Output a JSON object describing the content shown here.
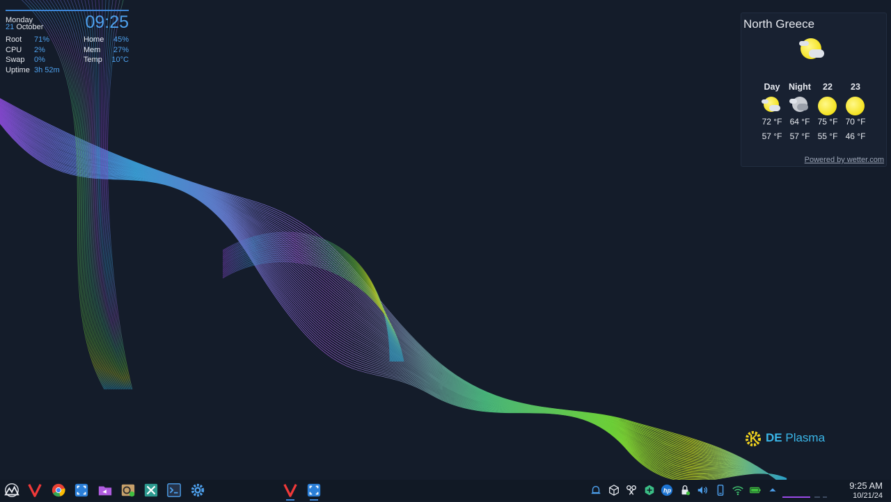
{
  "sysmon": {
    "day": "Monday",
    "date_num": "21",
    "month": "October",
    "time": "09:25",
    "rows": [
      {
        "l1": "Root",
        "v1": "71%",
        "l2": "Home",
        "v2": "45%"
      },
      {
        "l1": "CPU",
        "v1": "2%",
        "l2": "Mem",
        "v2": "27%"
      },
      {
        "l1": "Swap",
        "v1": "0%",
        "l2": "Temp",
        "v2": "10°C"
      },
      {
        "l1": "Uptime",
        "v1": "3h 52m"
      }
    ]
  },
  "weather": {
    "location": "North Greece",
    "current_icon": "sun-cloud-icon",
    "forecast": [
      {
        "label": "Day",
        "icon": "sun-cloud-icon",
        "high": "72 °F",
        "low": "57 °F"
      },
      {
        "label": "Night",
        "icon": "moon-cloud-icon",
        "high": "64 °F",
        "low": "57 °F"
      },
      {
        "label": "22",
        "icon": "sun-icon",
        "high": "75 °F",
        "low": "55 °F"
      },
      {
        "label": "23",
        "icon": "sun-icon",
        "high": "70 °F",
        "low": "46 °F"
      }
    ],
    "powered_by": "Powered by wetter.com"
  },
  "branding": {
    "logo_k": "K",
    "logo_de": "DE",
    "logo_plasma": "Plasma"
  },
  "taskbar": {
    "launchers": [
      "app-launcher-icon",
      "vivaldi-icon",
      "chrome-icon",
      "spectacle-icon",
      "file-manager-icon",
      "package-installer-icon",
      "system-tools-icon",
      "terminal-icon",
      "settings-icon"
    ],
    "tasks": [
      "vivaldi-task-icon",
      "spectacle-task-icon"
    ],
    "tray": [
      "notification-icon",
      "package-updates-icon",
      "kdeconnect-icon",
      "network-share-icon",
      "hp-printer-icon",
      "vault-icon",
      "volume-icon",
      "phone-icon",
      "wifi-icon",
      "battery-icon",
      "tray-expand-icon"
    ],
    "time": "9:25 AM",
    "date": "10/21/24"
  },
  "colors": {
    "accent": "#4ea1ee",
    "panel": "#111925",
    "background": "#141c2a"
  }
}
